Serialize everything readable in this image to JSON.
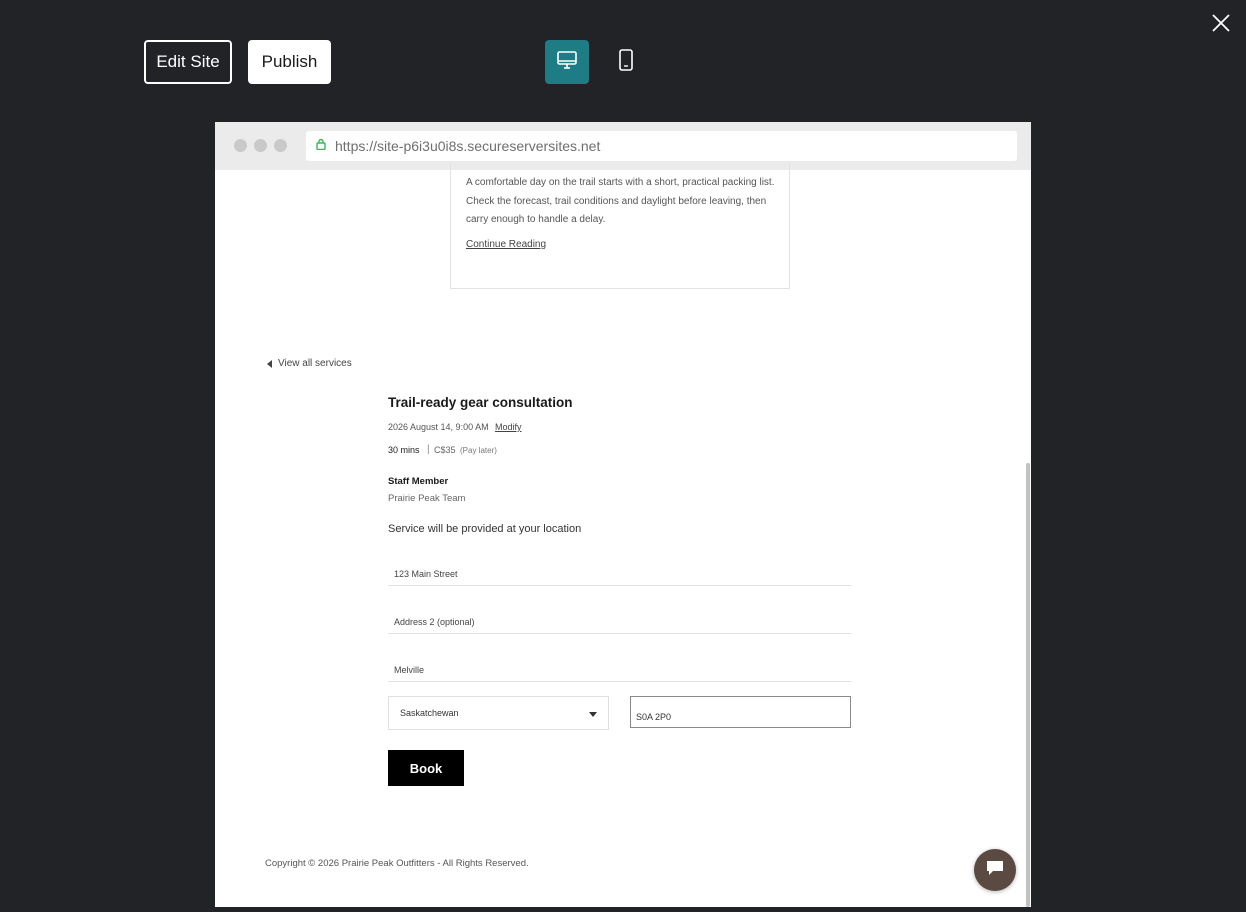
{
  "toolbar": {
    "edit_label": "Edit Site",
    "publish_label": "Publish",
    "desktop_icon": "desktop-icon",
    "mobile_icon": "mobile-icon",
    "close_icon": "close-icon",
    "accent_color": "#1d7c84"
  },
  "browser": {
    "url": "https://site-p6i3u0i8s.secureserversites.net"
  },
  "blog": {
    "excerpt": "A comfortable day on the trail starts with a short, practical packing list. Check the forecast, trail conditions and daylight before leaving, then carry enough to handle a delay.",
    "continue_label": "Continue Reading"
  },
  "booking": {
    "view_all_label": "View all services",
    "service_title": "Trail-ready gear consultation",
    "date_time": "2026 August 14, 9:00 AM",
    "modify_label": "Modify",
    "duration": "30 mins",
    "separator": "|",
    "price": "C$35",
    "payment_note": "(Pay later)",
    "staff_label": "Staff Member",
    "staff_name": "Prairie Peak Team",
    "location_note": "Service will be provided at your location",
    "address1": "123 Main Street",
    "address2_placeholder": "Address 2 (optional)",
    "city": "Melville",
    "province": "Saskatchewan",
    "postal_code": "S0A 2P0",
    "book_label": "Book"
  },
  "footer": {
    "copyright": "Copyright © 2026 Prairie Peak Outfitters - All Rights Reserved."
  },
  "chat": {
    "icon": "chat-icon"
  }
}
